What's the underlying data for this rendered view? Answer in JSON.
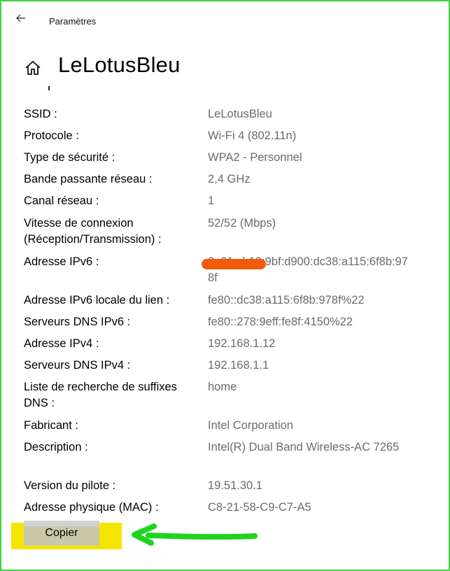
{
  "window": {
    "title": "Paramètres"
  },
  "page": {
    "title": "LeLotusBleu"
  },
  "properties": [
    {
      "label": "SSID :",
      "value": "LeLotusBleu"
    },
    {
      "label": "Protocole :",
      "value": "Wi-Fi 4 (802.11n)"
    },
    {
      "label": "Type de sécurité :",
      "value": "WPA2 - Personnel"
    },
    {
      "label": "Bande passante réseau :",
      "value": "2,4 GHz"
    },
    {
      "label": "Canal réseau :",
      "value": "1"
    },
    {
      "label": "Vitesse de connexion (Réception/Transmission) :",
      "value": "52/52 (Mbps)"
    },
    {
      "label": "Adresse IPv6 :",
      "value": "2a01:cb19:9bf:d900:dc38:a115:6f8b:978f"
    },
    {
      "label": "Adresse IPv6 locale du lien :",
      "value": "fe80::dc38:a115:6f8b:978f%22"
    },
    {
      "label": "Serveurs DNS IPv6 :",
      "value": "fe80::278:9eff:fe8f:4150%22"
    },
    {
      "label": "Adresse IPv4 :",
      "value": "192.168.1.12"
    },
    {
      "label": "Serveurs DNS IPv4 :",
      "value": "192.168.1.1"
    },
    {
      "label": "Liste de recherche de suffixes DNS :",
      "value": "home"
    },
    {
      "label": "Fabricant :",
      "value": "Intel Corporation"
    },
    {
      "label": "Description :",
      "value": "Intel(R) Dual Band Wireless-AC 7265"
    },
    {
      "label": "Version du pilote :",
      "value": "19.51.30.1"
    },
    {
      "label": "Adresse physique (MAC) :",
      "value": "C8-21-58-C9-C7-A5"
    }
  ],
  "actions": {
    "copy_label": "Copier"
  },
  "icons": {
    "back": "back-arrow-icon",
    "home": "home-icon"
  },
  "colors": {
    "frame_border": "#3fd43f",
    "highlight": "#f4e500",
    "annotation_arrow": "#1fd41f",
    "redaction": "#f25a0a",
    "value_text": "#6b6b6b"
  }
}
